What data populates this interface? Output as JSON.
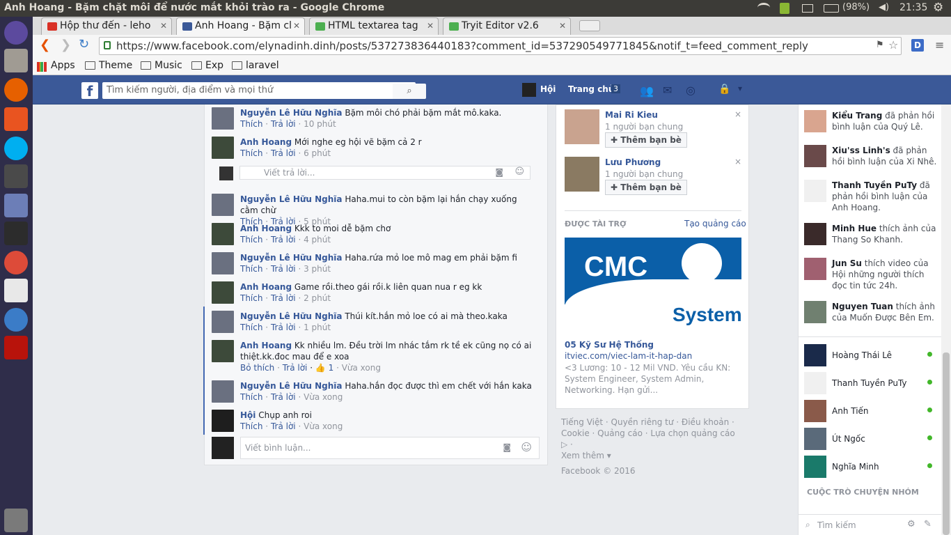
{
  "window": {
    "title": "Anh Hoang - Bặm chặt môi để nước mắt khỏi trào ra - Google Chrome",
    "battery": "(98%)",
    "time": "21:35"
  },
  "tabs": [
    {
      "label": "Hộp thư đến - leho",
      "color": "#d93025"
    },
    {
      "label": "Anh Hoang - Bặm cl",
      "color": "#3b5998"
    },
    {
      "label": "HTML textarea tag",
      "color": "#4caf50"
    },
    {
      "label": "Tryit Editor v2.6",
      "color": "#4caf50"
    }
  ],
  "url": "https://www.facebook.com/elynadinh.dinh/posts/537273836440183?comment_id=537290549771845&notif_t=feed_comment_reply",
  "bookmarks": [
    "Apps",
    "Theme",
    "Music",
    "Exp",
    "laravel"
  ],
  "fb": {
    "search_placeholder": "Tìm kiếm người, địa điểm và mọi thứ",
    "user": "Hội",
    "home": "Trang chủ",
    "home_count": "3"
  },
  "comments": [
    {
      "name": "Nguyễn Lê Hữu Nghĩa",
      "text": "Bặm môi chó phải bặm mắt mô.kaka.",
      "like": "Thích",
      "reply": "Trả lời",
      "time": "10 phút"
    },
    {
      "name": "Anh Hoang",
      "text": "Mới nghe eg hội vẽ bặm cả 2 r",
      "like": "Thích",
      "reply": "Trả lời",
      "time": "6 phút"
    },
    {
      "name": "Nguyễn Lê Hữu Nghĩa",
      "text": "Haha.mui to còn bặm lại hắn chạy xuống cằm chừ",
      "like": "Thích",
      "reply": "Trả lời",
      "time": "5 phút"
    },
    {
      "name": "Anh Hoang",
      "text": "Kkk to moi dễ bặm chơ",
      "like": "Thích",
      "reply": "Trả lời",
      "time": "4 phút"
    },
    {
      "name": "Nguyễn Lê Hữu Nghĩa",
      "text": "Haha.rứa mỏ loe mô mag em phải bặm fi",
      "like": "Thích",
      "reply": "Trả lời",
      "time": "3 phút"
    },
    {
      "name": "Anh Hoang",
      "text": "Game rồi.theo gái rồi.k liên quan nua r eg kk",
      "like": "Thích",
      "reply": "Trả lời",
      "time": "2 phút"
    },
    {
      "name": "Nguyễn Lê Hữu Nghĩa",
      "text": "Thúi kít.hắn mỏ loe có ai mà theo.kaka",
      "like": "Thích",
      "reply": "Trả lời",
      "time": "1 phút"
    },
    {
      "name": "Anh Hoang",
      "text": "Kk nhiều lm. Đều trời lm nhác tắm rk tề ek cũng nọ có ai thiệt.kk.đoc mau để e xoa",
      "like": "Bỏ thích",
      "reply": "Trả lời",
      "time": "Vừa xong",
      "likes": "1"
    },
    {
      "name": "Nguyễn Lê Hữu Nghĩa",
      "text": "Haha.hắn đọc được thì em chết với hắn kaka",
      "like": "Thích",
      "reply": "Trả lời",
      "time": "Vừa xong"
    },
    {
      "name": "Hội",
      "text": "Chụp anh roi",
      "like": "Thích",
      "reply": "Trả lời",
      "time": "Vừa xong"
    }
  ],
  "reply_placeholder": "Viết trả lời...",
  "comment_placeholder": "Viết bình luận...",
  "suggest": [
    {
      "name": "Mai Ri Kieu",
      "mutual": "1 người bạn chung",
      "btn": "Thêm bạn bè"
    },
    {
      "name": "Lưu Phương",
      "mutual": "1 người bạn chung",
      "btn": "Thêm bạn bè"
    }
  ],
  "ad": {
    "header": "ĐƯỢC TÀI TRỢ",
    "create": "Tạo quảng cáo",
    "logo": "CMC",
    "logo2": "System",
    "title": "05 Kỹ Sư Hệ Thống",
    "link": "itviec.com/viec-lam-it-hap-dan",
    "desc": "<3 Lương: 10 - 12 Mil VND. Yêu cầu KN: System Engineer, System Admin, Networking. Hạn gửi..."
  },
  "footer": {
    "l1": "Tiếng Việt · Quyền riêng tư · Điều khoản ·",
    "l2": "Cookie · Quảng cáo · Lựa chọn quảng cáo ▷ ·",
    "l3": "Xem thêm ▾",
    "copy": "Facebook © 2016"
  },
  "ticker": [
    {
      "bold": "Kiểu Trang",
      "rest": " đã phản hồi bình luận của Quý Lê."
    },
    {
      "bold": "Xiu'ss Linh's",
      "rest": " đã phản hồi bình luận của Xi Nhê."
    },
    {
      "bold": "Thanh Tuyền PuTy",
      "rest": " đã phản hồi bình luận của Anh Hoang."
    },
    {
      "bold": "Minh Hue",
      "rest": " thích ảnh của Thang So Khanh."
    },
    {
      "bold": "Jun Su",
      "rest": " thích video của Hội những người thích đọc tin tức 24h."
    },
    {
      "bold": "Nguyen Tuan",
      "rest": " thích ảnh của Muốn Được Bên Em."
    }
  ],
  "chat": [
    "Hoàng Thái Lê",
    "Thanh Tuyền PuTy",
    "Anh Tiến",
    "Út Ngốc",
    "Nghĩa Minh"
  ],
  "group_header": "CUỘC TRÒ CHUYỆN NHÓM",
  "chat_search": "Tìm kiếm"
}
